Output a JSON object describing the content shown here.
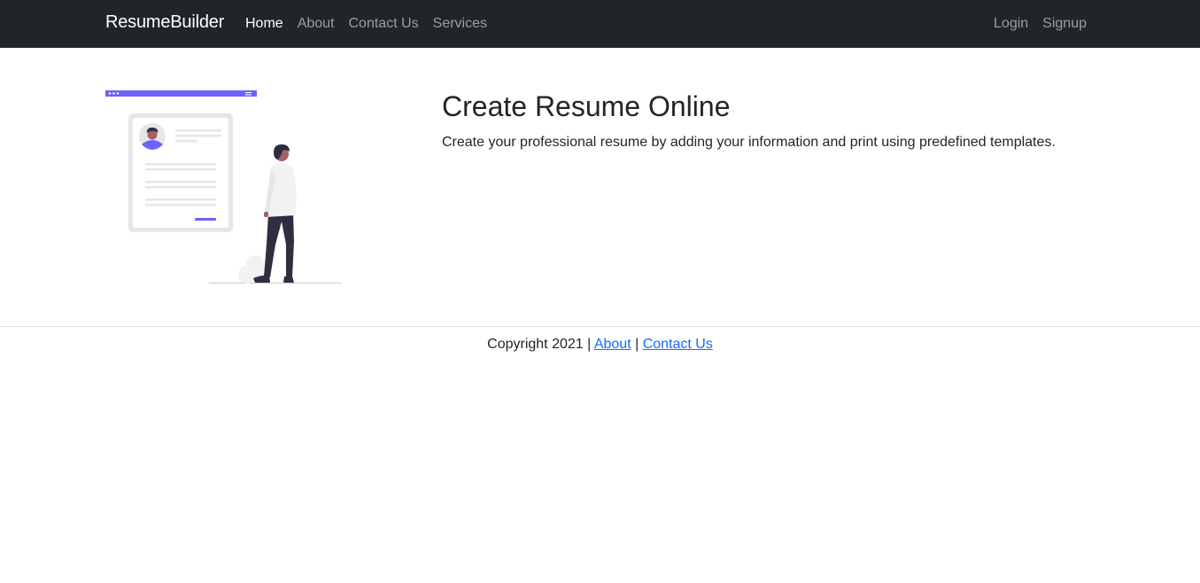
{
  "navbar": {
    "brand": "ResumeBuilder",
    "links": [
      {
        "label": "Home",
        "active": true
      },
      {
        "label": "About",
        "active": false
      },
      {
        "label": "Contact Us",
        "active": false
      },
      {
        "label": "Services",
        "active": false
      }
    ],
    "auth": {
      "login": "Login",
      "signup": "Signup"
    }
  },
  "hero": {
    "illustration_icon": "resume-illustration-icon",
    "title": "Create Resume Online",
    "description": "Create your professional resume by adding your information and print using predefined templates."
  },
  "footer": {
    "copyright": "Copyright 2021",
    "separator": "|",
    "about": "About",
    "contact": "Contact Us"
  },
  "colors": {
    "navbar_bg": "#212529",
    "accent": "#6c63ff",
    "link": "#0d6efd"
  }
}
